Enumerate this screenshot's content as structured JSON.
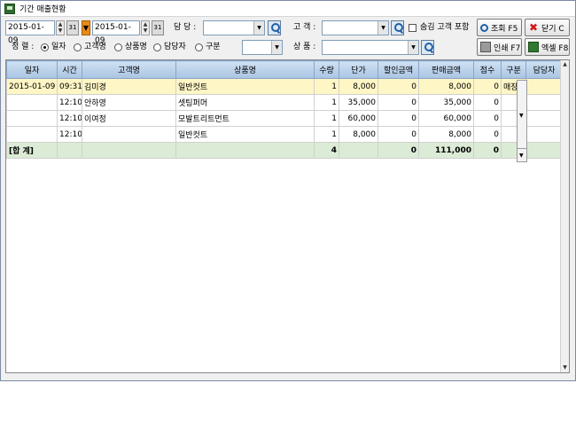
{
  "window": {
    "title": "기간 매출현황"
  },
  "filters": {
    "date_from": "2015-01-09",
    "date_to": "2015-01-09",
    "cal_label": "31",
    "staff_label": "담 당 :",
    "staff_value": "",
    "customer_label": "고 객 :",
    "customer_value": "",
    "hidden_customer_label": "숨김 고객 포함",
    "sort_label": "정 렬 :",
    "sort_options": [
      "일자",
      "고객명",
      "상품명",
      "담당자",
      "구분"
    ],
    "sort_selected": "일자",
    "sort_extra_value": "",
    "product_label": "상 품 :",
    "product_value": ""
  },
  "buttons": {
    "search": "조회 F5",
    "close": "닫기 C",
    "print": "인쇄 F7",
    "excel": "엑셀 F8"
  },
  "grid": {
    "columns": [
      "일자",
      "시간",
      "고객명",
      "상품명",
      "수량",
      "단가",
      "할인금액",
      "판매금액",
      "점수",
      "구분",
      "담당자"
    ],
    "rows": [
      {
        "date": "2015-01-09",
        "time": "09:31",
        "customer": "김미경",
        "product": "일반컷트",
        "qty": "1",
        "price": "8,000",
        "discount": "0",
        "amount": "8,000",
        "points": "0",
        "type": "매장",
        "staff": ""
      },
      {
        "date": "",
        "time": "12:10",
        "customer": "안하영",
        "product": "셋팅퍼머",
        "qty": "1",
        "price": "35,000",
        "discount": "0",
        "amount": "35,000",
        "points": "0",
        "type": "",
        "staff": ""
      },
      {
        "date": "",
        "time": "12:10",
        "customer": "이여정",
        "product": "모발트리트먼트",
        "qty": "1",
        "price": "60,000",
        "discount": "0",
        "amount": "60,000",
        "points": "0",
        "type": "",
        "staff": ""
      },
      {
        "date": "",
        "time": "12:10",
        "customer": "",
        "product": "일반컷트",
        "qty": "1",
        "price": "8,000",
        "discount": "0",
        "amount": "8,000",
        "points": "0",
        "type": "",
        "staff": ""
      }
    ],
    "total": {
      "label": "[합 계]",
      "qty": "4",
      "discount": "0",
      "amount": "111,000",
      "points": "0"
    }
  }
}
